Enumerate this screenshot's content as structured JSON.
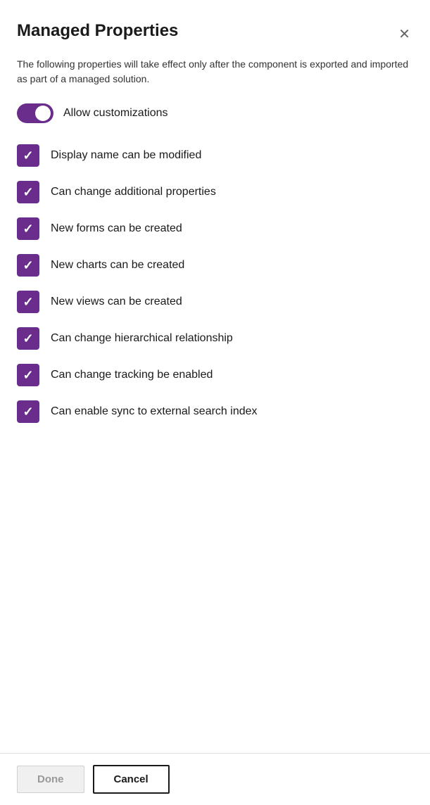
{
  "dialog": {
    "title": "Managed Properties",
    "description": "The following properties will take effect only after the component is exported and imported as part of a managed solution.",
    "close_label": "✕"
  },
  "toggle": {
    "label": "Allow customizations",
    "checked": true
  },
  "checkboxes": [
    {
      "id": "display-name",
      "label": "Display name can be modified",
      "checked": true
    },
    {
      "id": "additional-props",
      "label": "Can change additional properties",
      "checked": true
    },
    {
      "id": "new-forms",
      "label": "New forms can be created",
      "checked": true
    },
    {
      "id": "new-charts",
      "label": "New charts can be created",
      "checked": true
    },
    {
      "id": "new-views",
      "label": "New views can be created",
      "checked": true
    },
    {
      "id": "hierarchical",
      "label": "Can change hierarchical relationship",
      "checked": true
    },
    {
      "id": "tracking",
      "label": "Can change tracking be enabled",
      "checked": true
    },
    {
      "id": "sync-external",
      "label": "Can enable sync to external search index",
      "checked": true
    }
  ],
  "footer": {
    "done_label": "Done",
    "cancel_label": "Cancel"
  }
}
